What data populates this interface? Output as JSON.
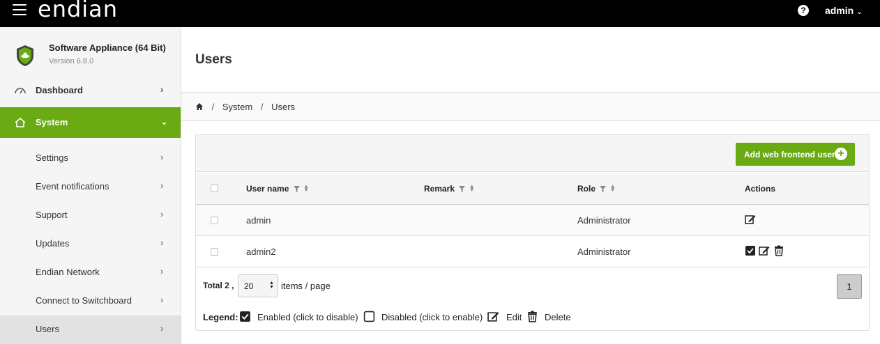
{
  "topbar": {
    "logo": "endian",
    "help_symbol": "?",
    "user": "admin",
    "user_chevron": "⌄"
  },
  "sidebar": {
    "appliance_name": "Software Appliance (64 Bit)",
    "version": "Version 6.8.0",
    "items": [
      {
        "label": "Dashboard"
      },
      {
        "label": "System"
      },
      {
        "label": "Settings"
      },
      {
        "label": "Event notifications"
      },
      {
        "label": "Support"
      },
      {
        "label": "Updates"
      },
      {
        "label": "Endian Network"
      },
      {
        "label": "Connect to Switchboard"
      },
      {
        "label": "Users"
      }
    ],
    "chevron_right": "›",
    "chevron_down": "⌄"
  },
  "main": {
    "title": "Users",
    "breadcrumb": [
      "System",
      "Users"
    ],
    "breadcrumb_sep": "/",
    "add_button": "Add web frontend user",
    "add_button_symbol": "+"
  },
  "table": {
    "columns": [
      "User name",
      "Remark",
      "Role",
      "Actions"
    ],
    "rows": [
      {
        "username": "admin",
        "remark": "",
        "role": "Administrator"
      },
      {
        "username": "admin2",
        "remark": "",
        "role": "Administrator"
      }
    ],
    "total_label": "Total 2 ,",
    "per_page": "20",
    "items_label": "items / page",
    "page": "1"
  },
  "legend": {
    "title": "Legend:",
    "enabled": "Enabled (click to disable)",
    "disabled": "Disabled (click to enable)",
    "edit": "Edit",
    "delete": "Delete"
  },
  "colors": {
    "accent": "#6aaa13",
    "topbar": "#000000",
    "sidebar_bg": "#f5f5f5"
  }
}
